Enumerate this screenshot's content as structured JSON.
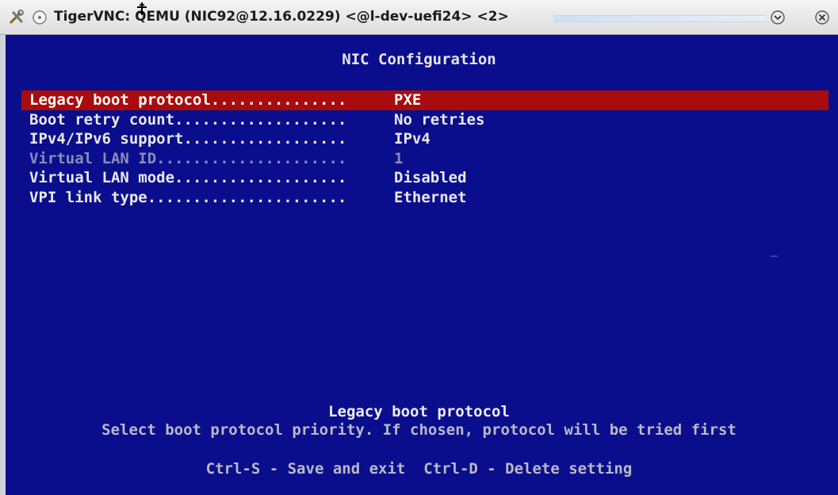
{
  "window": {
    "title": "TigerVNC: QEMU (NIC92@12.16.0229) <@l-dev-uefi24> <2>",
    "icons": {
      "app": "tools-icon",
      "menu": "circle-icon",
      "minimize": "chevron-down-circle-icon",
      "close": "close-circle-icon"
    }
  },
  "screen": {
    "title": "NIC Configuration",
    "items": [
      {
        "label": "Legacy boot protocol",
        "dots": "...............",
        "value": "PXE",
        "selected": true,
        "disabled": false
      },
      {
        "label": "Boot retry count",
        "dots": "...................",
        "value": "No retries",
        "selected": false,
        "disabled": false
      },
      {
        "label": "IPv4/IPv6 support",
        "dots": "..................",
        "value": "IPv4",
        "selected": false,
        "disabled": false
      },
      {
        "label": "Virtual LAN ID",
        "dots": ".....................",
        "value": "1",
        "selected": false,
        "disabled": true
      },
      {
        "label": "Virtual LAN mode",
        "dots": "...................",
        "value": "Disabled",
        "selected": false,
        "disabled": false
      },
      {
        "label": "VPI link type",
        "dots": "......................",
        "value": "Ethernet",
        "selected": false,
        "disabled": false
      }
    ],
    "help": {
      "title": "Legacy boot protocol",
      "text": "Select boot protocol priority. If chosen, protocol will be tried first"
    },
    "keys": "Ctrl-S - Save and exit  Ctrl-D - Delete setting"
  },
  "colors": {
    "background": "#0b0e8c",
    "selection": "#a80c0c",
    "text": "#e9e9e9",
    "disabled_text": "#8a8db8"
  }
}
